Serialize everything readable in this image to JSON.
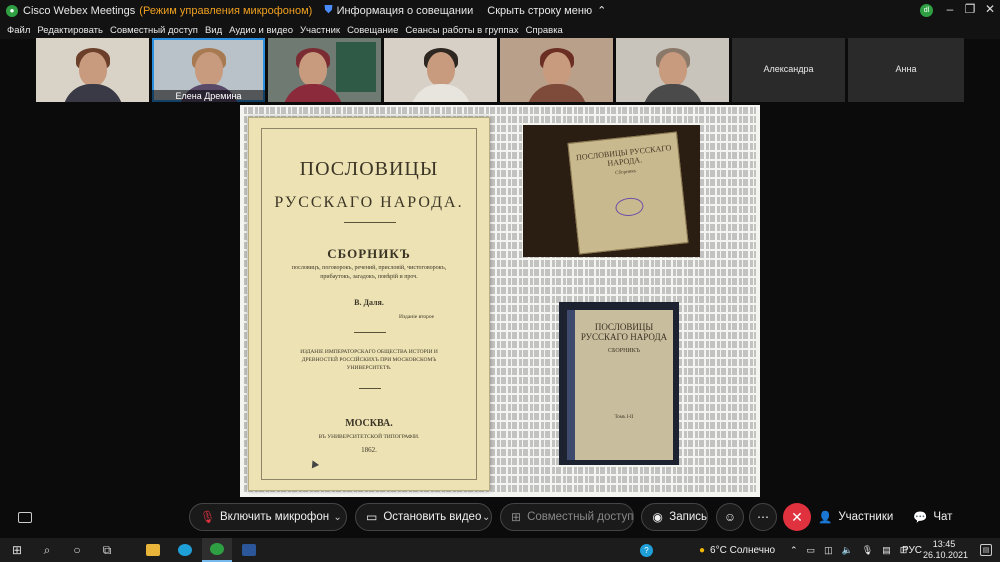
{
  "window": {
    "app_title": "Cisco Webex Meetings",
    "mode": "(Режим управления микрофоном)",
    "meeting_info": "Информация о совещании",
    "hide_menu": "Скрыть строку меню",
    "user_initials": "dl",
    "accent": "#f0a020"
  },
  "menu": [
    "Файл",
    "Редактировать",
    "Совместный доступ",
    "Вид",
    "Аудио и видео",
    "Участник",
    "Совещание",
    "Сеансы работы в группах",
    "Справка"
  ],
  "participants": [
    {
      "name": "",
      "active": false
    },
    {
      "name": "Елена Дремина",
      "active": true
    },
    {
      "name": "",
      "active": false
    },
    {
      "name": "",
      "active": false
    },
    {
      "name": "",
      "active": false
    },
    {
      "name": "",
      "active": false
    },
    {
      "name": "Александра",
      "active": false
    },
    {
      "name": "Анна",
      "active": false
    }
  ],
  "shared": {
    "page": {
      "title1": "ПОСЛОВИЦЫ",
      "title2": "РУССКАГО НАРОДА.",
      "title3": "СБОРНИКЪ",
      "subtitle": "пословицъ, поговорокъ, речений, присловій, чистоговорокъ, прибаутокъ, загадокъ, повѣрій и проч.",
      "author": "В. Даля.",
      "note": "Изданіе второе",
      "publisher": "ИЗДАНІЕ ИМПЕРАТОРСКАГО ОБЩЕСТВА ИСТОРІИ И ДРЕВНОСТЕЙ РОССІЙСКИХЪ ПРИ МОСКОВСКОМЪ УНИВЕРСИТЕТѢ.",
      "city": "МОСКВА.",
      "press": "ВЪ УНИВЕРСИТЕТСКОЙ ТИПОГРАФІИ.",
      "year": "1862."
    },
    "photo1": {
      "title": "ПОСЛОВИЦЫ РУССКАГО НАРОДА.",
      "sub": "Сборникъ"
    },
    "photo2": {
      "title": "ПОСЛОВИЦЫ РУССКАГО НАРОДА",
      "sub": "СБОРНИКЪ",
      "footer": "Томъ I-II"
    }
  },
  "controls": {
    "mic": "Включить микрофон",
    "video": "Остановить видео",
    "share": "Совместный доступ",
    "record": "Запись",
    "participants": "Участники",
    "chat": "Чат"
  },
  "taskbar": {
    "weather": "6°C  Солнечно",
    "lang": "РУС",
    "time": "13:45",
    "date": "26.10.2021"
  }
}
